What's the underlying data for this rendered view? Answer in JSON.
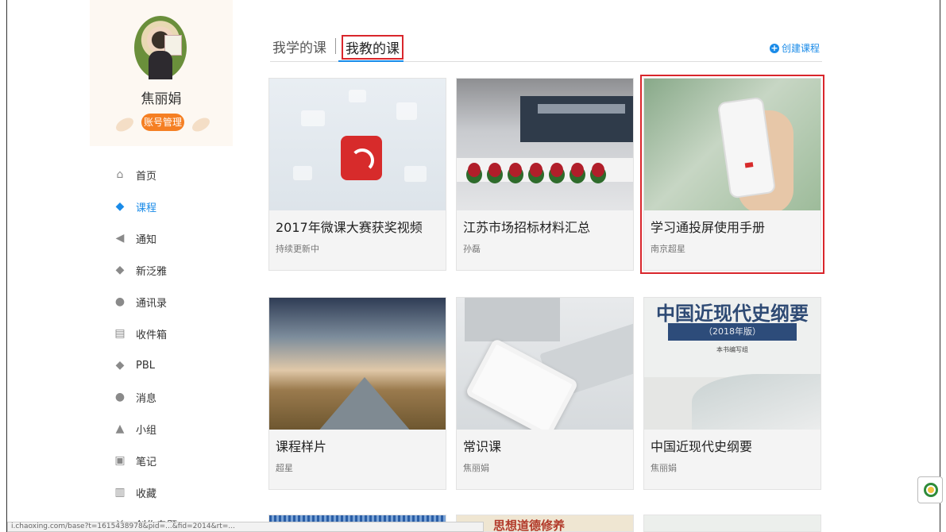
{
  "profile": {
    "name": "焦丽娟",
    "account_button": "账号管理"
  },
  "nav": [
    {
      "label": "首页",
      "icon": "home-icon",
      "active": false
    },
    {
      "label": "课程",
      "icon": "course-icon",
      "active": true
    },
    {
      "label": "通知",
      "icon": "speaker-icon",
      "active": false
    },
    {
      "label": "新泛雅",
      "icon": "diamond-icon",
      "active": false
    },
    {
      "label": "通讯录",
      "icon": "contacts-icon",
      "active": false
    },
    {
      "label": "收件箱",
      "icon": "inbox-icon",
      "active": false
    },
    {
      "label": "PBL",
      "icon": "diamond-icon",
      "active": false
    },
    {
      "label": "消息",
      "icon": "chat-icon",
      "active": false
    },
    {
      "label": "小组",
      "icon": "group-icon",
      "active": false
    },
    {
      "label": "笔记",
      "icon": "note-icon",
      "active": false
    },
    {
      "label": "收藏",
      "icon": "bookmark-icon",
      "active": false
    },
    {
      "label": "创作专题",
      "icon": "topic-icon",
      "active": false
    }
  ],
  "tabs": {
    "learn": "我学的课",
    "teach": "我教的课",
    "active": "teach"
  },
  "create_course": "创建课程",
  "courses": [
    {
      "title": "2017年微课大赛获奖视频",
      "author": "持续更新中"
    },
    {
      "title": "江苏市场招标材料汇总",
      "author": "孙磊"
    },
    {
      "title": "学习通投屏使用手册",
      "author": "南京超星"
    },
    {
      "title": "课程样片",
      "author": "超星"
    },
    {
      "title": "常识课",
      "author": "焦丽娟"
    },
    {
      "title": "中国近现代史纲要",
      "author": "焦丽娟"
    }
  ],
  "book_cover": {
    "title": "中国近现代史纲要",
    "edition": "（2018年版）",
    "editor": "本书编写组"
  },
  "partial_card_text": "思想道德修养",
  "status_url": "i.chaoxing.com/base?t=1615438978&pid=...&fid=2014&rt=...",
  "colors": {
    "accent": "#1a8be8",
    "highlight": "#d9262c",
    "orange": "#f57f23"
  }
}
